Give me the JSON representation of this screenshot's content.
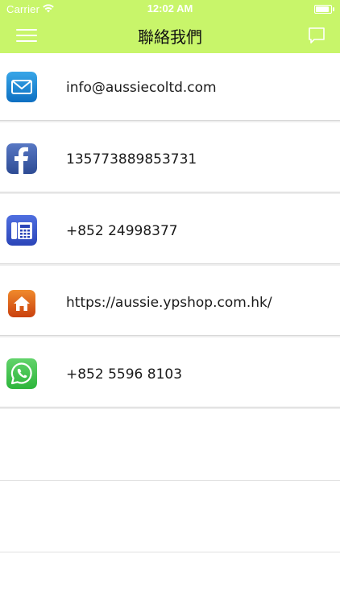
{
  "status_bar": {
    "carrier": "Carrier",
    "time": "12:02 AM"
  },
  "nav": {
    "title": "聯絡我們",
    "background_color": "#c8f56a"
  },
  "contacts": [
    {
      "icon": "email-icon",
      "value": "info@aussieco ltd.com"
    },
    {
      "icon": "facebook-icon",
      "value": "135773889853731"
    },
    {
      "icon": "phone-icon",
      "value": "+852 24998377"
    },
    {
      "icon": "home-icon",
      "value": "https://aussie.ypshop.com.hk/"
    },
    {
      "icon": "whatsapp-icon",
      "value": "+852 5596 8103"
    }
  ]
}
